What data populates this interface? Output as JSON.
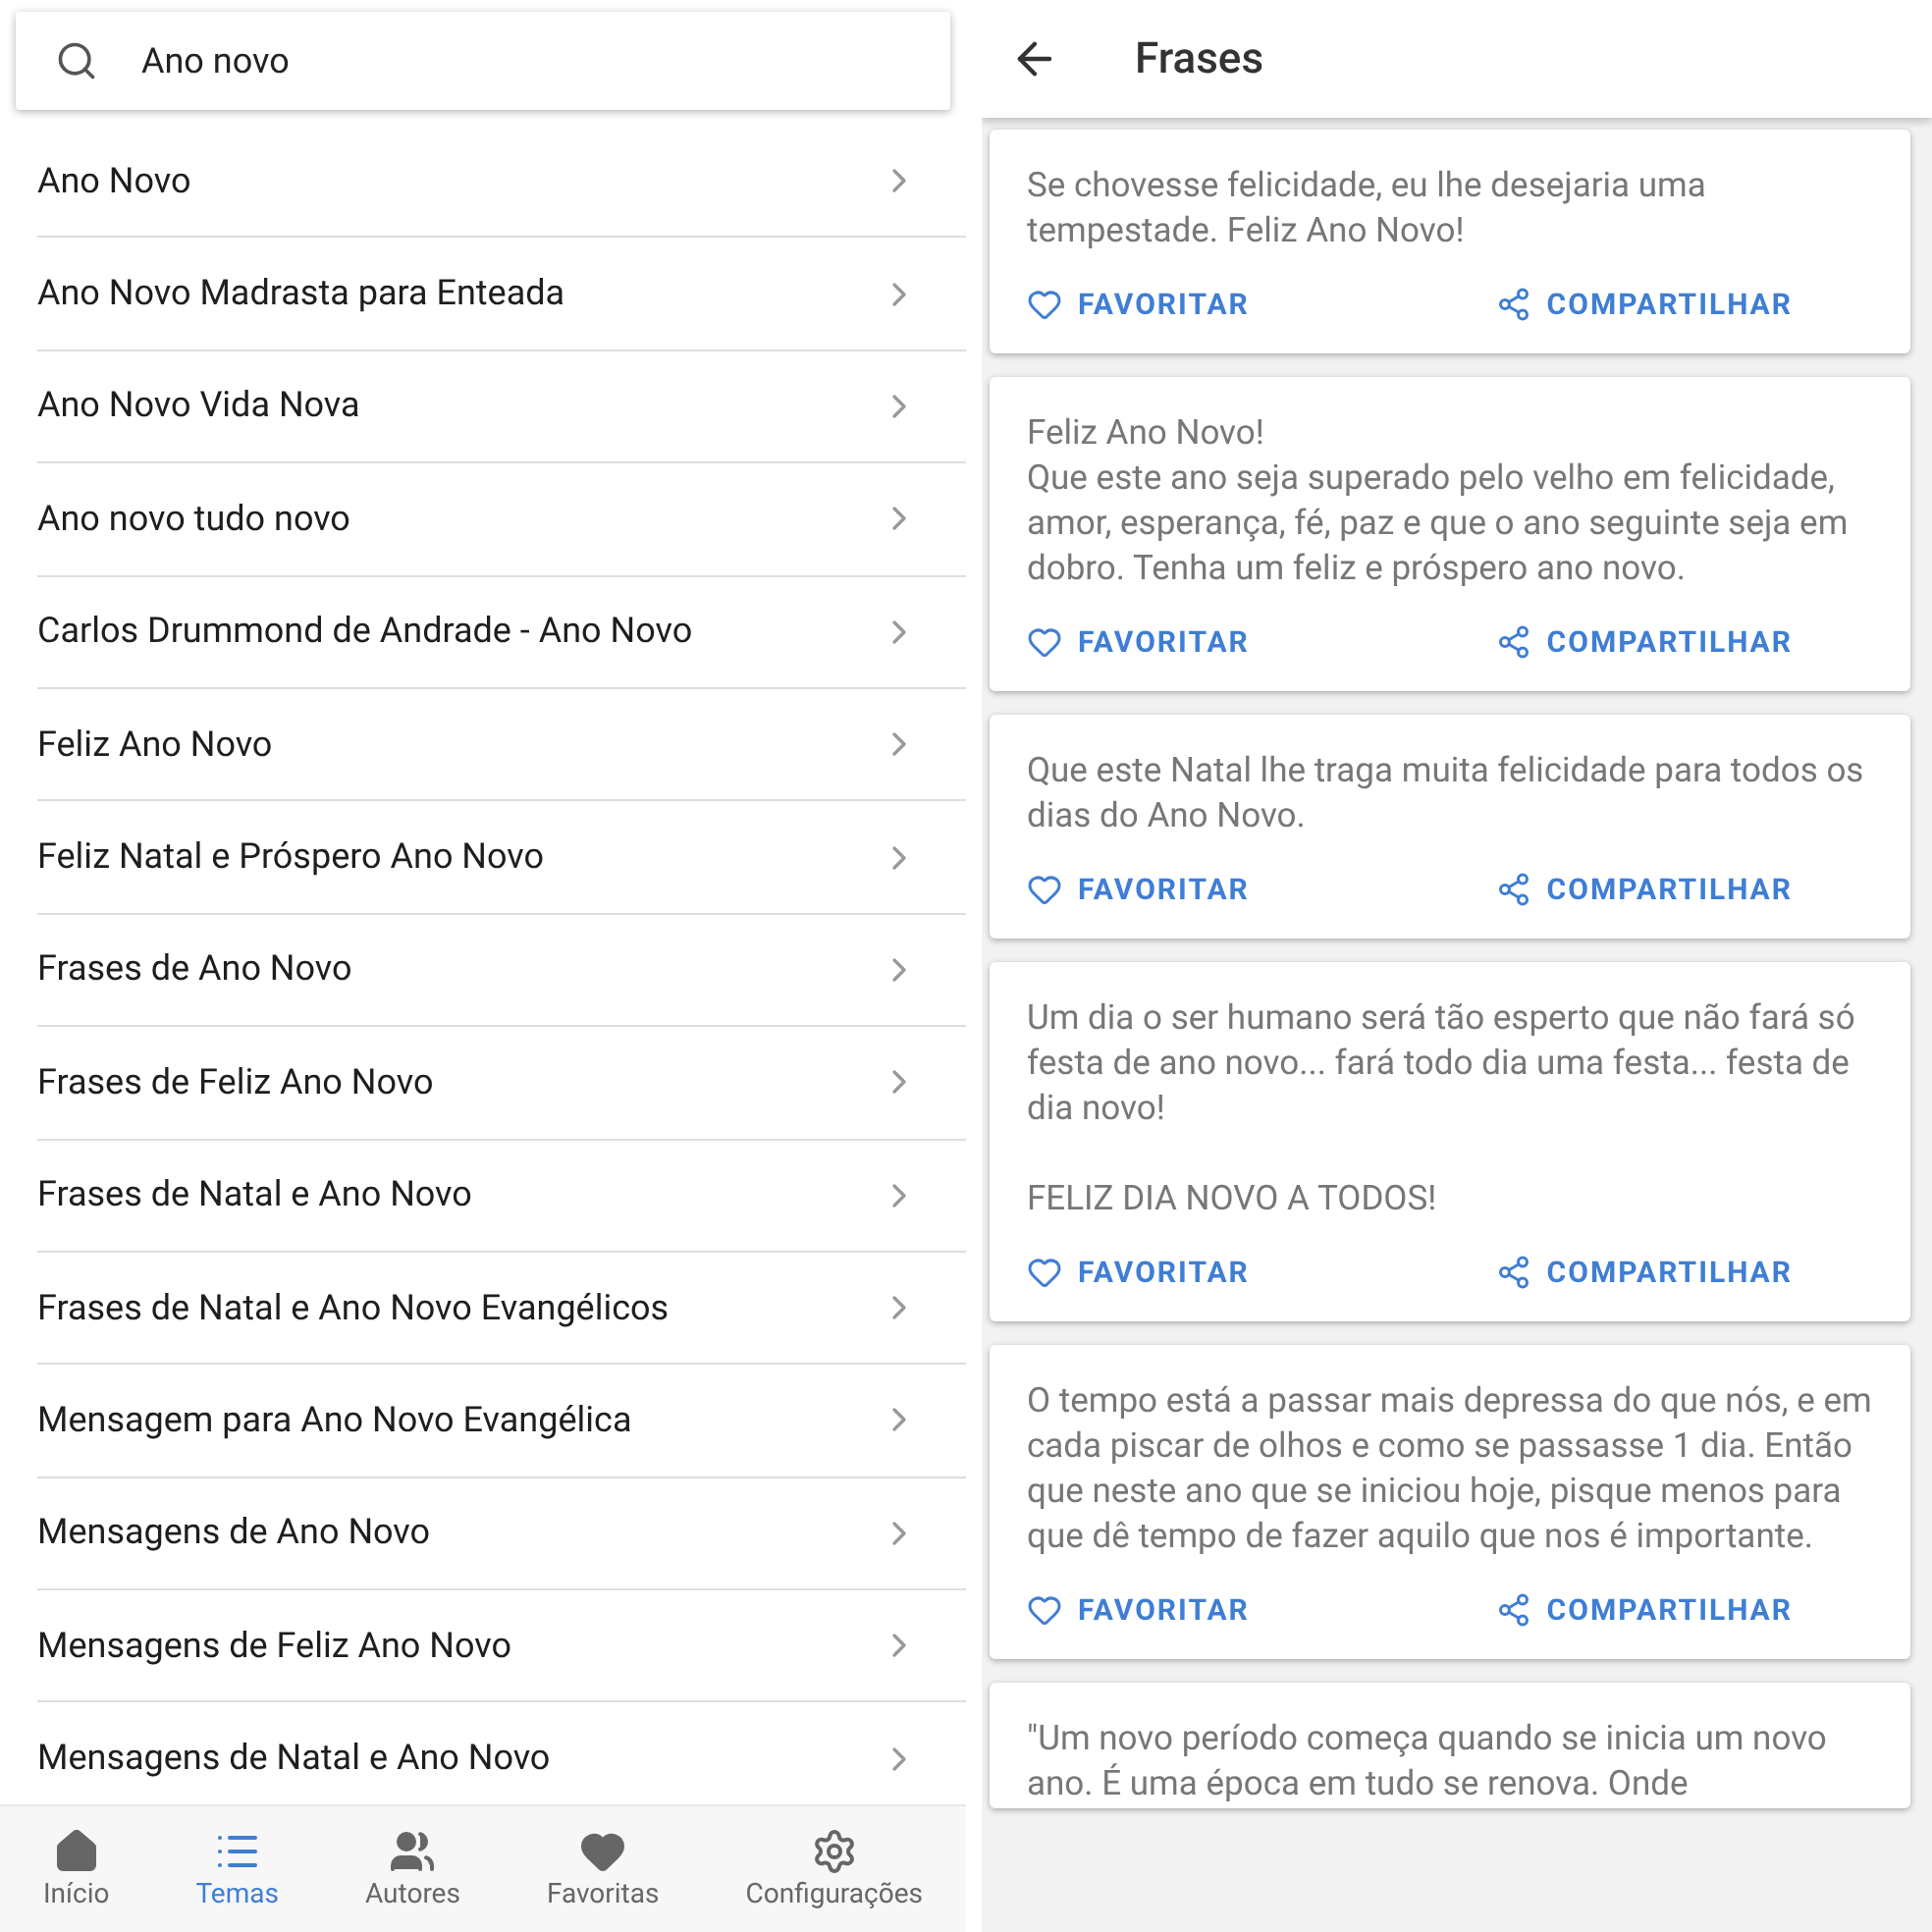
{
  "search": {
    "value": "Ano novo"
  },
  "topics": [
    {
      "label": "Ano Novo"
    },
    {
      "label": "Ano Novo Madrasta para Enteada"
    },
    {
      "label": "Ano Novo Vida Nova"
    },
    {
      "label": "Ano novo tudo novo"
    },
    {
      "label": "Carlos Drummond de Andrade - Ano Novo"
    },
    {
      "label": "Feliz Ano Novo"
    },
    {
      "label": "Feliz Natal e Próspero Ano Novo"
    },
    {
      "label": "Frases de Ano Novo"
    },
    {
      "label": "Frases de Feliz Ano Novo"
    },
    {
      "label": "Frases de Natal e Ano Novo"
    },
    {
      "label": "Frases de Natal e Ano Novo Evangélicos"
    },
    {
      "label": "Mensagem para Ano Novo Evangélica"
    },
    {
      "label": "Mensagens de Ano Novo"
    },
    {
      "label": "Mensagens de Feliz Ano Novo"
    },
    {
      "label": "Mensagens de Natal e Ano Novo"
    }
  ],
  "bottom_nav": [
    {
      "kind": "home",
      "label": "Início",
      "selected": false
    },
    {
      "kind": "list",
      "label": "Temas",
      "selected": true
    },
    {
      "kind": "people",
      "label": "Autores",
      "selected": false
    },
    {
      "kind": "heart",
      "label": "Favoritas",
      "selected": false
    },
    {
      "kind": "gear",
      "label": "Configurações",
      "selected": false
    }
  ],
  "phrases_screen": {
    "title": "Frases",
    "cards": [
      {
        "text": "Se chovesse felicidade, eu lhe desejaria uma tempestade. Feliz Ano Novo!",
        "favorite": "FAVORITAR",
        "share": "COMPARTILHAR"
      },
      {
        "text": "Feliz Ano Novo!\nQue este ano seja superado pelo velho em felicidade, amor, esperança, fé, paz e que o ano seguinte seja em dobro. Tenha um feliz e próspero ano novo.",
        "favorite": "FAVORITAR",
        "share": "COMPARTILHAR"
      },
      {
        "text": "Que este Natal lhe traga muita felicidade para todos os dias do Ano Novo.",
        "favorite": "FAVORITAR",
        "share": "COMPARTILHAR"
      },
      {
        "text": "Um dia o ser humano será tão esperto que não fará só festa de ano novo... fará todo dia uma festa... festa de dia novo!\n\nFELIZ DIA NOVO A TODOS!",
        "favorite": "FAVORITAR",
        "share": "COMPARTILHAR"
      },
      {
        "text": "O tempo está a passar mais depressa do que nós, e em cada piscar de olhos e como se passasse 1 dia. Então que neste ano que se iniciou hoje, pisque menos para que dê tempo de fazer aquilo que nos é importante.",
        "favorite": "FAVORITAR",
        "share": "COMPARTILHAR"
      },
      {
        "text": "\"Um novo período começa quando se inicia um novo ano. É uma época em tudo se renova. Onde"
      }
    ]
  }
}
